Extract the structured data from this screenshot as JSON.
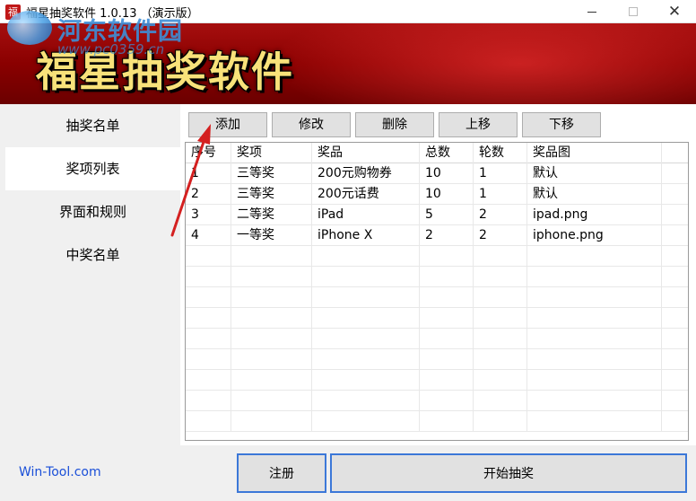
{
  "window": {
    "title": "福星抽奖软件 1.0.13 （演示版）",
    "app_icon_glyph": "福",
    "minimize_icon": "minimize-icon",
    "maximize_icon": "maximize-icon",
    "close_glyph": "✕"
  },
  "watermark": {
    "text": "河东软件园",
    "url": "www.pc0359.cn"
  },
  "banner": {
    "title": "福星抽奖软件",
    "color": "#8a0000",
    "title_color": "#f8e27a"
  },
  "sidebar": {
    "items": [
      {
        "label": "抽奖名单",
        "active": false
      },
      {
        "label": "奖项列表",
        "active": true
      },
      {
        "label": "界面和规则",
        "active": false
      },
      {
        "label": "中奖名单",
        "active": false
      }
    ]
  },
  "toolbar": {
    "add": "添加",
    "edit": "修改",
    "delete": "删除",
    "move_up": "上移",
    "move_down": "下移"
  },
  "table": {
    "headers": [
      "序号",
      "奖项",
      "奖品",
      "总数",
      "轮数",
      "奖品图"
    ],
    "rows": [
      [
        "1",
        "三等奖",
        "200元购物券",
        "10",
        "1",
        "默认"
      ],
      [
        "2",
        "三等奖",
        "200元话费",
        "10",
        "1",
        "默认"
      ],
      [
        "3",
        "二等奖",
        "iPad",
        "5",
        "2",
        "ipad.png"
      ],
      [
        "4",
        "一等奖",
        "iPhone X",
        "2",
        "2",
        "iphone.png"
      ]
    ],
    "empty_rows": 9
  },
  "footer": {
    "site": "Win-Tool.com",
    "register": "注册",
    "start": "开始抽奖"
  },
  "colors": {
    "accent_border": "#3c78d8",
    "link": "#1a4fd8",
    "annotation_arrow": "#d42020"
  }
}
